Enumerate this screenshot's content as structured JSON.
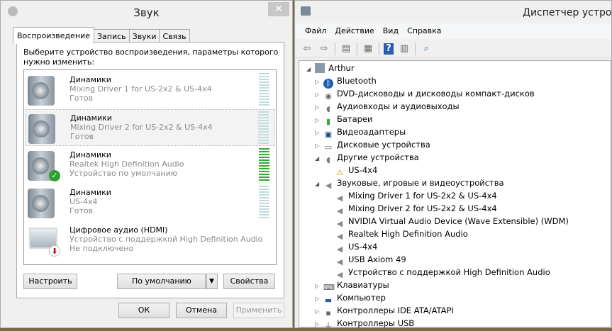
{
  "sound": {
    "title": "Звук",
    "close": "✕",
    "tabs": [
      "Воспроизведение",
      "Запись",
      "Звуки",
      "Связь"
    ],
    "prompt": "Выберите устройство воспроизведения, параметры которого нужно изменить:",
    "devices": [
      {
        "name": "Динамики",
        "driver": "Mixing Driver 1 for US-2x2 & US-4x4",
        "status": "Готов",
        "icon": "speaker-icon",
        "level": 0
      },
      {
        "name": "Динамики",
        "driver": "Mixing Driver 2 for US-2x2 & US-4x4",
        "status": "Готов",
        "icon": "speaker-icon",
        "level": 0,
        "selected": true
      },
      {
        "name": "Динамики",
        "driver": "Realtek High Definition Audio",
        "status": "Устройство по умолчанию",
        "icon": "speaker-icon",
        "badge": "check-icon",
        "level": 1
      },
      {
        "name": "Динамики",
        "driver": "US-4x4",
        "status": "Готов",
        "icon": "speaker-icon",
        "level": 0
      },
      {
        "name": "Цифровое аудио (HDMI)",
        "driver": "Устройство с поддержкой High Definition Audio",
        "status": "Не подключено",
        "icon": "monitor-icon",
        "badge": "disconnected-icon"
      }
    ],
    "buttons": {
      "configure": "Настроить",
      "default": "По умолчанию",
      "properties": "Свойства",
      "ok": "ОК",
      "cancel": "Отмена",
      "apply": "Применить"
    },
    "colors": {
      "meter_active": "#3aa63a",
      "meter_idle": "#c0dde0"
    }
  },
  "devmgr": {
    "title": "Диспетчер устройств",
    "menu": [
      "Файл",
      "Действие",
      "Вид",
      "Справка"
    ],
    "toolbar": [
      "back-icon",
      "forward-icon",
      "show-hide-tree-icon",
      "properties-icon",
      "help-icon",
      "run-icon",
      "scan-hardware-icon"
    ],
    "root": "Arthur",
    "tree": [
      {
        "label": "Bluetooth",
        "level": 1,
        "expanded": false,
        "icon": "bluetooth-icon"
      },
      {
        "label": "DVD-дисководы и дисководы компакт-дисков",
        "level": 1,
        "expanded": false,
        "icon": "dvd-icon"
      },
      {
        "label": "Аудиовходы и аудиовыходы",
        "level": 1,
        "expanded": false,
        "icon": "audio-io-icon"
      },
      {
        "label": "Батареи",
        "level": 1,
        "expanded": false,
        "icon": "battery-icon"
      },
      {
        "label": "Видеоадаптеры",
        "level": 1,
        "expanded": false,
        "icon": "display-adapter-icon"
      },
      {
        "label": "Дисковые устройства",
        "level": 1,
        "expanded": false,
        "icon": "disk-icon"
      },
      {
        "label": "Другие устройства",
        "level": 1,
        "expanded": true,
        "icon": "other-devices-icon"
      },
      {
        "label": "US-4x4",
        "level": 2,
        "icon": "warning-device-icon"
      },
      {
        "label": "Звуковые, игровые и видеоустройства",
        "level": 1,
        "expanded": true,
        "icon": "sound-icon"
      },
      {
        "label": "Mixing Driver 1 for US-2x2 & US-4x4",
        "level": 2,
        "icon": "sound-icon"
      },
      {
        "label": "Mixing Driver 2 for US-2x2 & US-4x4",
        "level": 2,
        "icon": "sound-icon"
      },
      {
        "label": "NVIDIA Virtual Audio Device (Wave Extensible) (WDM)",
        "level": 2,
        "icon": "sound-icon"
      },
      {
        "label": "Realtek High Definition Audio",
        "level": 2,
        "icon": "sound-icon"
      },
      {
        "label": "US-4x4",
        "level": 2,
        "icon": "sound-icon"
      },
      {
        "label": "USB Axiom 49",
        "level": 2,
        "icon": "sound-icon"
      },
      {
        "label": "Устройство с поддержкой High Definition Audio",
        "level": 2,
        "icon": "sound-icon"
      },
      {
        "label": "Клавиатуры",
        "level": 1,
        "expanded": false,
        "icon": "keyboard-icon"
      },
      {
        "label": "Компьютер",
        "level": 1,
        "expanded": false,
        "icon": "computer-icon"
      },
      {
        "label": "Контроллеры IDE ATA/ATAPI",
        "level": 1,
        "expanded": false,
        "icon": "ide-icon"
      },
      {
        "label": "Контроллеры USB",
        "level": 1,
        "expanded": false,
        "icon": "usb-icon"
      }
    ]
  }
}
